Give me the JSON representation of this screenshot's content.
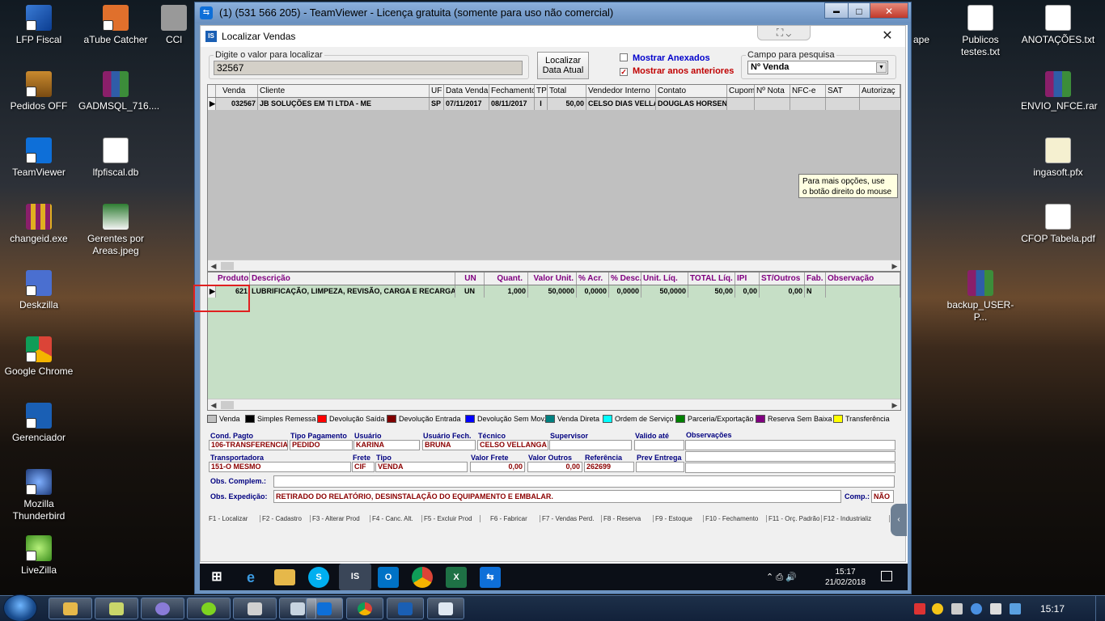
{
  "desktop": {
    "icons_left": [
      {
        "label": "LFP Fiscal",
        "icon": "shield-icon"
      },
      {
        "label": "aTube Catcher",
        "icon": "atube-icon"
      },
      {
        "label": "CCl",
        "icon": "app-icon"
      },
      {
        "label": "Pedidos OFF",
        "icon": "briefcase-icon"
      },
      {
        "label": "GADMSQL_716....",
        "icon": "winrar-icon"
      },
      {
        "label": "TeamViewer",
        "icon": "teamviewer-icon"
      },
      {
        "label": "lfpfiscal.db",
        "icon": "database-file-icon"
      },
      {
        "label": "changeid.exe",
        "icon": "installer-icon"
      },
      {
        "label": "Gerentes por Areas.jpeg",
        "icon": "image-file-icon"
      },
      {
        "label": "Deskzilla",
        "icon": "deskzilla-icon"
      },
      {
        "label": "Google Chrome",
        "icon": "chrome-icon"
      },
      {
        "label": "Gerenciador",
        "icon": "is-logo-icon"
      },
      {
        "label": "Mozilla Thunderbird",
        "icon": "thunderbird-icon"
      },
      {
        "label": "LiveZilla",
        "icon": "livezilla-icon"
      }
    ],
    "icons_right": [
      {
        "label": "ape",
        "icon": "app-icon"
      },
      {
        "label": "Publicos testes.txt",
        "icon": "text-file-icon"
      },
      {
        "label": "ANOTAÇÕES.txt",
        "icon": "text-file-icon"
      },
      {
        "label": "ENVIO_NFCE.rar",
        "icon": "winrar-icon"
      },
      {
        "label": "ingasoft.pfx",
        "icon": "certificate-icon"
      },
      {
        "label": "CFOP Tabela.pdf",
        "icon": "pdf-file-icon"
      },
      {
        "label": "backup_USER-P...",
        "icon": "winrar-icon"
      }
    ]
  },
  "teamviewer": {
    "title": "(1) (531 566 205) - TeamViewer - Licença gratuita (somente para uso não comercial)",
    "min": "▬",
    "max": "□",
    "close": "✕",
    "panel_label": "⛶ ⌄"
  },
  "app": {
    "title": "Localizar Vendas",
    "close": "✕",
    "search": {
      "legend": "Digite o valor para localizar",
      "value": "32567"
    },
    "btn_localizar": {
      "line1": "Localizar",
      "line2": "Data Atual"
    },
    "chk_anexados": {
      "label": "Mostrar Anexados",
      "checked": false,
      "color": "#0000cc"
    },
    "chk_anteriores": {
      "label": "Mostrar anos anteriores",
      "checked": true,
      "mark": "✓",
      "color": "#c00000"
    },
    "campo": {
      "legend": "Campo para pesquisa",
      "value": "Nº Venda"
    },
    "sales_grid": {
      "headers": [
        "Venda",
        "Cliente",
        "UF",
        "Data Venda",
        "Fechamento",
        "TP",
        "Total",
        "Vendedor Interno",
        "Contato",
        "Cupom",
        "Nº Nota",
        "NFC-e",
        "SAT",
        "Autorizaç"
      ],
      "rows": [
        [
          "032567",
          "JB SOLUÇÕES EM TI LTDA - ME",
          "SP",
          "07/11/2017",
          "08/11/2017",
          "I",
          "50,00",
          "CELSO DIAS VELLA",
          "DOUGLAS HORSEN",
          "",
          "",
          "",
          "",
          ""
        ]
      ]
    },
    "tooltip": {
      "line1": "Para mais opções, use",
      "line2": "o botão direito do mouse"
    },
    "items_grid": {
      "headers": [
        "Produto",
        "Descrição",
        "UN",
        "Quant.",
        "Valor Unit.",
        "% Acr.",
        "% Desc.",
        "Unit. Líq.",
        "TOTAL Líq.",
        "IPI",
        "ST/Outros",
        "Fab.",
        "Observação"
      ],
      "rows": [
        [
          "621",
          "LUBRIFICAÇÃO, LIMPEZA, REVISÃO, CARGA E RECARGA",
          "UN",
          "1,000",
          "50,0000",
          "0,0000",
          "0,0000",
          "50,0000",
          "50,00",
          "0,00",
          "0,00",
          "N",
          ""
        ]
      ]
    },
    "legend": [
      {
        "label": "Venda",
        "color": "#c0c0c0"
      },
      {
        "label": "Simples Remessa",
        "color": "#000000"
      },
      {
        "label": "Devolução Saída",
        "color": "#ff0000"
      },
      {
        "label": "Devolução Entrada",
        "color": "#800000"
      },
      {
        "label": "Devolução Sem Mov.",
        "color": "#0000ff"
      },
      {
        "label": "Venda Direta",
        "color": "#008080"
      },
      {
        "label": "Ordem de Serviço",
        "color": "#00ffff"
      },
      {
        "label": "Parceria/Exportação",
        "color": "#008000"
      },
      {
        "label": "Reserva Sem Baixa",
        "color": "#800080"
      },
      {
        "label": "Transferência",
        "color": "#ffff00"
      }
    ],
    "details": {
      "cond_pagto": {
        "label": "Cond. Pagto",
        "value": "106-TRANSFERENCIA"
      },
      "tipo_pagamento": {
        "label": "Tipo Pagamento",
        "value": "PEDIDO"
      },
      "usuario": {
        "label": "Usuário",
        "value": "KARINA"
      },
      "usuario_fech": {
        "label": "Usuário Fech.",
        "value": "BRUNA"
      },
      "tecnico": {
        "label": "Técnico",
        "value": "CELSO VELLANGA"
      },
      "supervisor": {
        "label": "Supervisor",
        "value": ""
      },
      "valido_ate": {
        "label": "Valido até",
        "value": ""
      },
      "observacoes": {
        "label": "Observações",
        "value": ""
      },
      "transportadora": {
        "label": "Transportadora",
        "value": "151-O MESMO"
      },
      "frete": {
        "label": "Frete",
        "value": "CIF"
      },
      "tipo": {
        "label": "Tipo",
        "value": "VENDA"
      },
      "valor_frete": {
        "label": "Valor Frete",
        "value": "0,00"
      },
      "valor_outros": {
        "label": "Valor Outros",
        "value": "0,00"
      },
      "referencia": {
        "label": "Referência",
        "value": "262699"
      },
      "prev_entrega": {
        "label": "Prev Entrega",
        "value": ""
      },
      "obs_complem": {
        "label": "Obs. Complem.:",
        "value": ""
      },
      "obs_expedicao": {
        "label": "Obs. Expedição:",
        "value": "RETIRADO DO RELATÓRIO, DESINSTALAÇÃO DO EQUIPAMENTO E EMBALAR."
      },
      "comp": {
        "label": "Comp.:",
        "value": "NÃO"
      }
    },
    "fkeys": [
      "F1 - Localizar",
      "F2 - Cadastro",
      "F3 - Alterar Prod",
      "F4 - Canc. Alt.",
      "F5 - Excluir Prod",
      "F6 - Fabricar",
      "F7 - Vendas Perd.",
      "F8 - Reserva",
      "F9 - Estoque",
      "F10 - Fechamento",
      "F11 - Orç. Padrão",
      "F12 - Industrializ"
    ],
    "side_tab": "‹"
  },
  "remote_taskbar": {
    "apps": [
      "start-icon",
      "edge-icon",
      "explorer-icon",
      "skype-icon",
      "is-logo-icon",
      "outlook-icon",
      "chrome-icon",
      "excel-icon",
      "teamviewer-icon"
    ],
    "time": "15:17",
    "date": "21/02/2018",
    "tray": "⌃ ⎙ 🔊"
  },
  "taskbar": {
    "apps": [
      "explorer-icon",
      "network-icon",
      "app-icon",
      "app-icon",
      "paint-icon",
      "calculator-icon",
      "teamviewer-icon",
      "chrome-icon",
      "is-logo-icon",
      "window-icon"
    ],
    "time": "15:17"
  }
}
